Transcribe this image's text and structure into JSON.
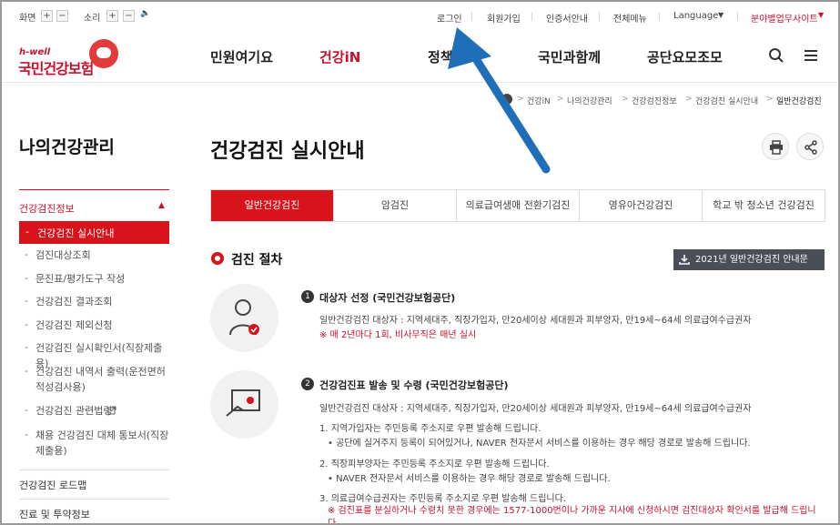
{
  "util": {
    "screen_label": "화면",
    "sound_label": "소리",
    "plus": "+",
    "minus": "−",
    "speaker": "🔈",
    "links": [
      "로그인",
      "회원가입",
      "인증서안내",
      "전체메뉴"
    ],
    "language": "Language",
    "business_sites": "분야별업무사이트",
    "caret": "▼"
  },
  "logo": {
    "small": "h-well",
    "name": "국민건강보험"
  },
  "gnb": [
    "민원여기요",
    "건강iN",
    "정책센터",
    "국민과함께",
    "공단요모조모"
  ],
  "breadcrumb": [
    "건강iN",
    "나의건강관리",
    "건강검진정보",
    "건강검진 실시안내",
    "일반건강검진"
  ],
  "sidebar": {
    "title": "나의건강관리",
    "section": "건강검진정보",
    "section_caret": "▲",
    "active": "건강검진 실시안내",
    "items": [
      "검진대상조회",
      "문진표/평가도구 작성",
      "건강검진 결과조회",
      "건강검진 제외신청",
      "건강검진 실시확인서(직장제출용)",
      "건강검진 내역서 출력(운전면허적성검사용)",
      "건강검진 관련법령",
      "채용 건강검진 대체 통보서(직장제출용)"
    ],
    "other_sections": [
      "건강검진 로드맵",
      "진료 및 투약정보"
    ]
  },
  "page": {
    "title": "건강검진 실시안내",
    "tabs": [
      "일반건강검진",
      "암검진",
      "의료급여생애 전환기검진",
      "영유아건강검진",
      "학교 밖 청소년 건강검진"
    ],
    "section_title": "검진 절차",
    "download_label": "2021년 일반건강검진 안내문"
  },
  "steps": [
    {
      "num": "1",
      "title": "대상자 선정 (국민건강보험공단)",
      "lines": [
        "일반건강검진 대상자 : 지역세대주, 직장가입자, 만20세이상 세대원과 피부양자, 만19세~64세 의료급여수급권자"
      ],
      "note": "※ 매 2년마다 1회, 비사무직은 매년 실시"
    },
    {
      "num": "2",
      "title": "건강검진표 발송 및 수령 (국민건강보험공단)",
      "lines": [
        "일반건강검진 대상자 : 지역세대주, 직장가입자, 만20세이상 세대원과 피부양자, 만19세~64세 의료급여수급권자",
        "1. 지역가입자는 주민등록 주소지로 우편 발송해 드립니다.",
        "• 공단에 실거주지 등록이 되어있거나, NAVER 전자문서 서비스를 이용하는 경우 해당 경로로 발송해 드립니다.",
        "2. 직장피부양자는 주민등록 주소지로 우편 발송해 드립니다.",
        "• NAVER 전자문서 서비스를 이용하는 경우 해당 경로로 발송해 드립니다.",
        "3. 의료급여수급권자는 주민등록 주소지로 우편 발송해 드립니다."
      ],
      "note": "※ 검진표를 분실하거나 수령치 못한 경우에는 1577-1000번이나 가까운 지사에 신청하시면 검진대상자 확인서를 발급해 드립니다."
    }
  ],
  "colors": {
    "accent": "#d8131b",
    "arrow": "#1f6fb8"
  }
}
